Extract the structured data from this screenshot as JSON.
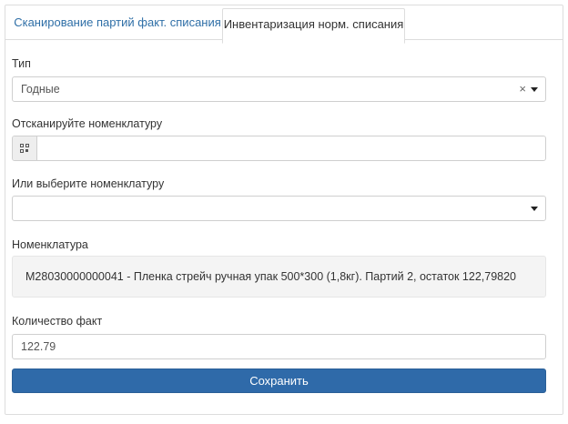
{
  "tabs": [
    {
      "label": "Сканирование партий факт. списания",
      "active": false
    },
    {
      "label": "Инвентаризация норм. списания",
      "active": true
    }
  ],
  "type_field": {
    "label": "Тип",
    "value": "Годные",
    "clear_glyph": "×"
  },
  "scan_field": {
    "label": "Отсканируйте номенклатуру",
    "icon": "qr-code-icon",
    "value": ""
  },
  "choose_field": {
    "label": "Или выберите номенклатуру",
    "value": ""
  },
  "nomenclature": {
    "label": "Номенклатура",
    "text": "М28030000000041 - Пленка стрейч ручная упак 500*300 (1,8кг). Партий 2, остаток 122,79820"
  },
  "quantity_field": {
    "label": "Количество факт",
    "value": "122.79"
  },
  "save_button": {
    "label": "Сохранить",
    "color": "#2f6aa9"
  },
  "colors": {
    "tab_link": "#2f6fa7",
    "border": "#dddddd",
    "info_bg": "#f4f4f4"
  }
}
